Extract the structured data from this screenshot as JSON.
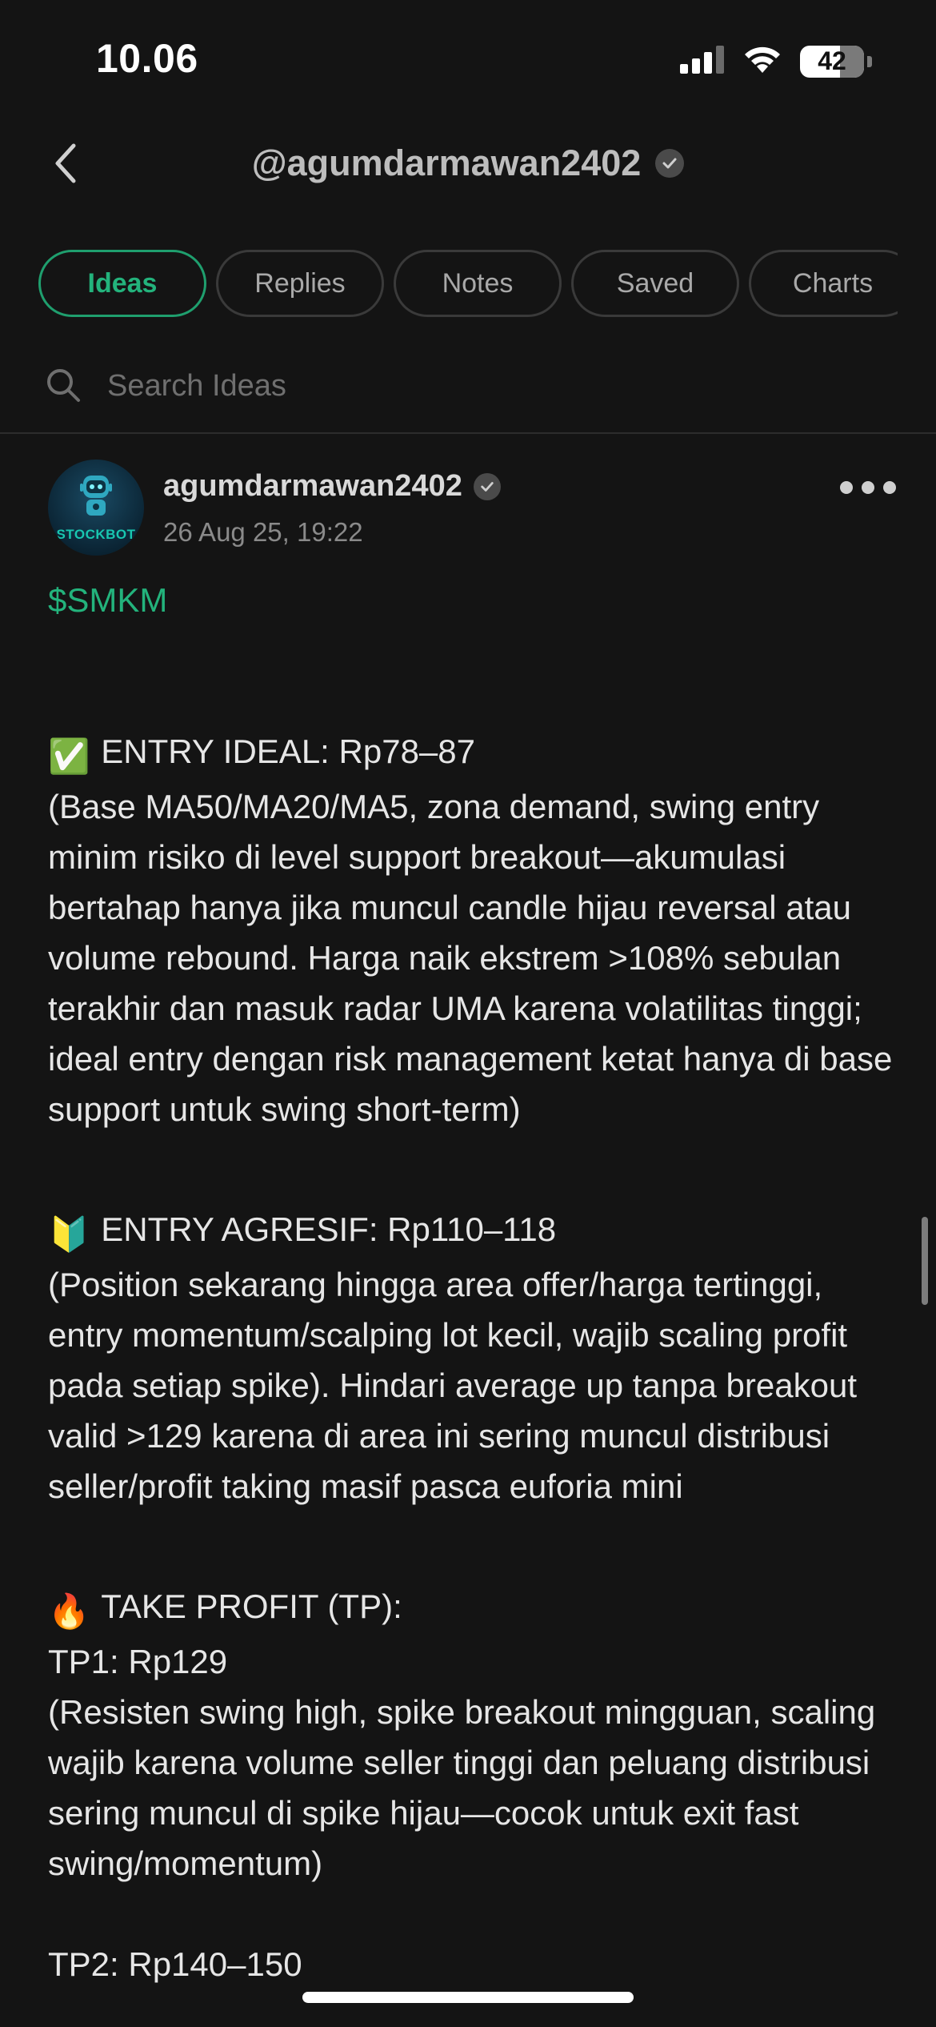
{
  "status_bar": {
    "time": "10.06",
    "battery": "42",
    "battery_level_percent": 42,
    "icons": [
      "cellular-signal-icon",
      "wifi-icon",
      "battery-icon"
    ]
  },
  "header": {
    "title": "@agumdarmawan2402",
    "back_icon": "chevron-left-icon",
    "verified_icon": "verified-check-icon"
  },
  "tabs": [
    {
      "label": "Ideas",
      "active": true
    },
    {
      "label": "Replies",
      "active": false
    },
    {
      "label": "Notes",
      "active": false
    },
    {
      "label": "Saved",
      "active": false
    },
    {
      "label": "Charts",
      "active": false
    }
  ],
  "search": {
    "placeholder": "Search Ideas",
    "value": ""
  },
  "post": {
    "avatar_label": "STOCKBOT",
    "author": "agumdarmawan2402",
    "timestamp": "26 Aug 25, 19:22",
    "ticker": "$SMKM",
    "sections": {
      "entry_ideal_emoji": "✅",
      "entry_ideal_title": "ENTRY IDEAL: Rp78–87",
      "entry_ideal_body": "(Base MA50/MA20/MA5, zona demand, swing entry minim risiko di level support breakout—akumulasi bertahap hanya jika muncul candle hijau reversal atau volume rebound. Harga naik ekstrem >108% sebulan terakhir dan masuk radar UMA karena volatilitas tinggi; ideal entry dengan risk management ketat hanya di base support untuk swing short-term)",
      "entry_agresif_emoji": "🔰",
      "entry_agresif_title": "ENTRY AGRESIF: Rp110–118",
      "entry_agresif_body": "(Position sekarang hingga area offer/harga tertinggi, entry momentum/scalping lot kecil, wajib scaling profit pada setiap spike). Hindari average up tanpa breakout valid >129 karena di area ini sering muncul distribusi seller/profit taking masif pasca euforia mini",
      "tp_emoji": "🔥",
      "tp_title": "TAKE PROFIT (TP):",
      "tp1": "TP1: Rp129",
      "tp1_body": "(Resisten swing high, spike breakout mingguan, scaling wajib karena volume seller tinggi dan peluang distribusi sering muncul di spike hijau—cocok untuk exit fast swing/momentum)",
      "tp2": "TP2: Rp140–150"
    }
  },
  "colors": {
    "background": "#141414",
    "accent_green": "#23b37c",
    "tab_border": "#3a3a3a",
    "text_primary": "#e6e6e6",
    "text_secondary": "#8a8a8a"
  }
}
